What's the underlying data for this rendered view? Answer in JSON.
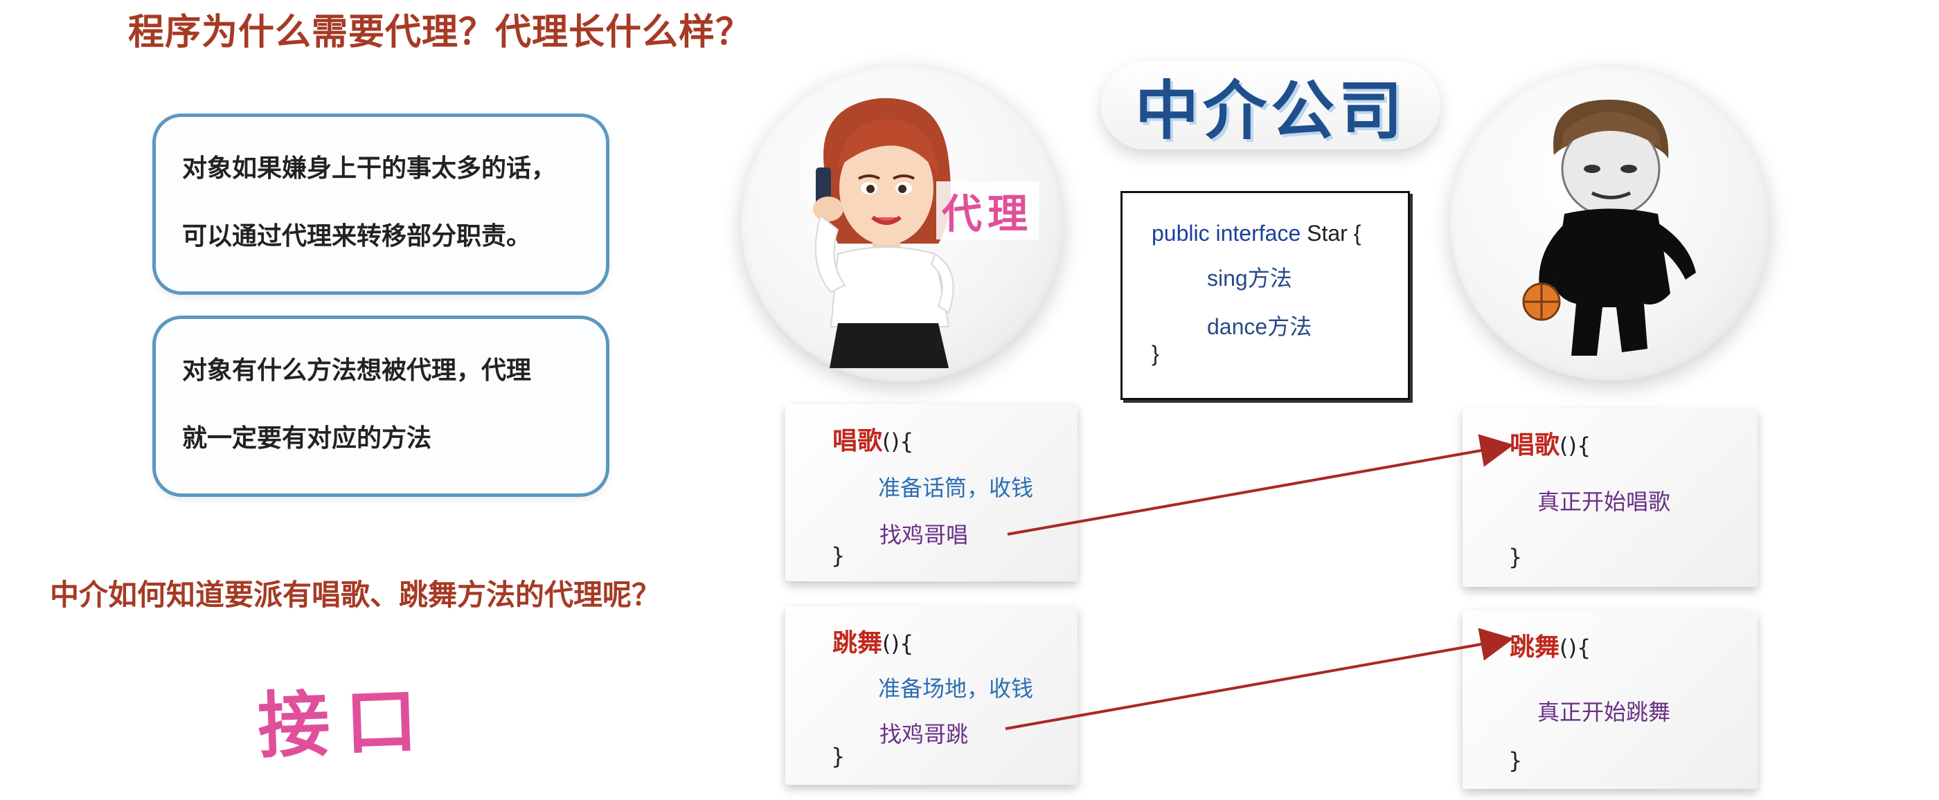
{
  "title": "程序为什么需要代理？代理长什么样？",
  "notes": [
    {
      "line1": "对象如果嫌身上干的事太多的话，",
      "line2": "可以通过代理来转移部分职责。"
    },
    {
      "line1": "对象有什么方法想被代理，代理",
      "line2": "就一定要有对应的方法"
    }
  ],
  "question": "中介如何知道要派有唱歌、跳舞方法的代理呢？",
  "answer": "接口",
  "agent_label": "代理",
  "company": "中介公司",
  "interface_box": {
    "decl_kw": "public interface",
    "decl_name": "Star {",
    "m1": "sing方法",
    "m2": "dance方法",
    "close": "}"
  },
  "proxy_methods": [
    {
      "name": "唱歌",
      "sig": "(){",
      "line1": "准备话筒，收钱",
      "line2": "找鸡哥唱",
      "close": "}"
    },
    {
      "name": "跳舞",
      "sig": "(){",
      "line1": "准备场地，收钱",
      "line2": "找鸡哥跳",
      "close": "}"
    }
  ],
  "star_methods": [
    {
      "name": "唱歌",
      "sig": "(){",
      "line1": "真正开始唱歌",
      "close": "}"
    },
    {
      "name": "跳舞",
      "sig": "(){",
      "line1": "真正开始跳舞",
      "close": "}"
    }
  ],
  "colors": {
    "title": "#a63a24",
    "note_border": "#5d97bf",
    "arrow": "#a92a22",
    "handwrite": "#e0509a"
  }
}
